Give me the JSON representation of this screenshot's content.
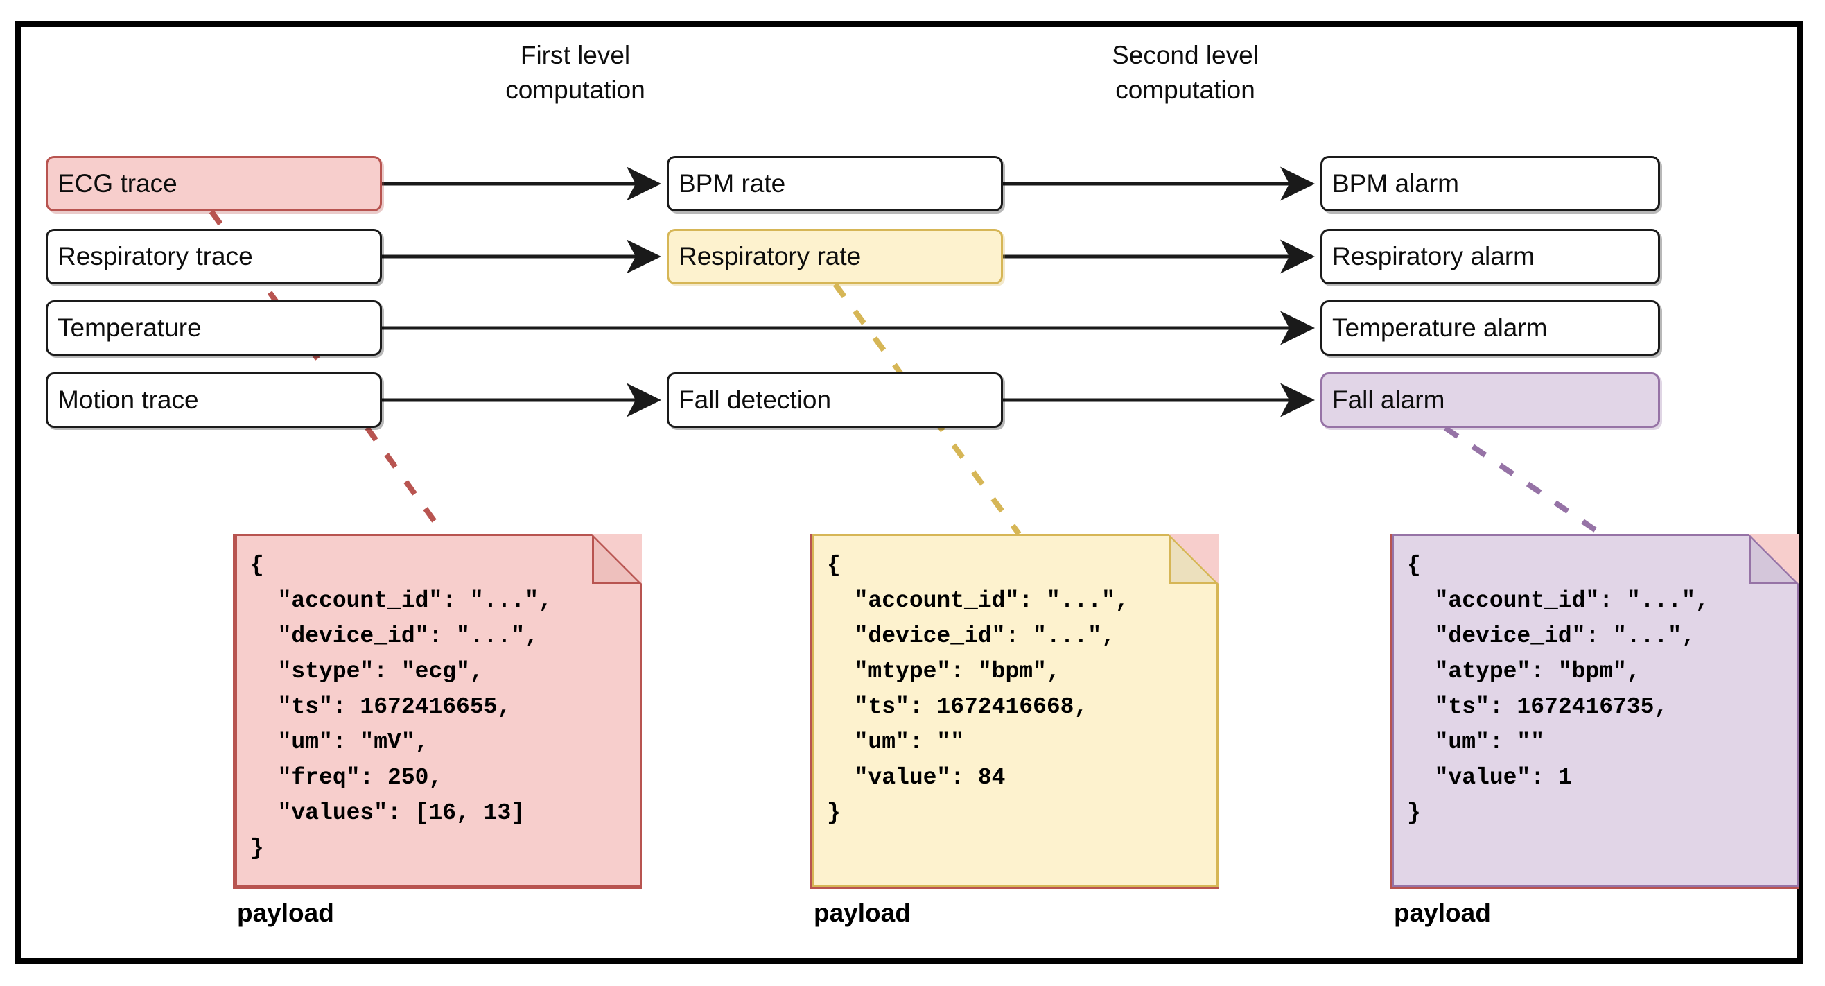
{
  "frame": {
    "border_color": "#000000",
    "background": "#ffffff"
  },
  "headings": {
    "first": "First level\ncomputation",
    "second": "Second level\ncomputation"
  },
  "palette": {
    "red_fill": "#f7cecc",
    "red_stroke": "#b85450",
    "yellow_fill": "#fdf2ce",
    "yellow_stroke": "#d6b656",
    "purple_fill": "#e1d5e7",
    "purple_stroke": "#9673a6",
    "default_stroke": "#1a1a1a",
    "default_fill": "#ffffff"
  },
  "columns": {
    "sources": {
      "nodes": [
        {
          "label": "ECG trace",
          "highlight": "red"
        },
        {
          "label": "Respiratory trace",
          "highlight": "none"
        },
        {
          "label": "Temperature",
          "highlight": "none"
        },
        {
          "label": "Motion trace",
          "highlight": "none"
        }
      ]
    },
    "first_level": {
      "nodes": [
        {
          "label": "BPM rate",
          "highlight": "none"
        },
        {
          "label": "Respiratory rate",
          "highlight": "yellow"
        },
        {
          "label": "Fall detection",
          "highlight": "none"
        }
      ]
    },
    "second_level": {
      "nodes": [
        {
          "label": "BPM alarm",
          "highlight": "none"
        },
        {
          "label": "Respiratory alarm",
          "highlight": "none"
        },
        {
          "label": "Temperature alarm",
          "highlight": "none"
        },
        {
          "label": "Fall alarm",
          "highlight": "purple"
        }
      ]
    }
  },
  "payloads": [
    {
      "caption": "payload",
      "color": "red",
      "code": "{\n  \"account_id\": \"...\",\n  \"device_id\": \"...\",\n  \"stype\": \"ecg\",\n  \"ts\": 1672416655,\n  \"um\": \"mV\",\n  \"freq\": 250,\n  \"values\": [16, 13]\n}"
    },
    {
      "caption": "payload",
      "color": "yellow",
      "code": "{\n  \"account_id\": \"...\",\n  \"device_id\": \"...\",\n  \"mtype\": \"bpm\",\n  \"ts\": 1672416668,\n  \"um\": \"\"\n  \"value\": 84\n}"
    },
    {
      "caption": "payload",
      "color": "purple",
      "code": "{\n  \"account_id\": \"...\",\n  \"device_id\": \"...\",\n  \"atype\": \"bpm\",\n  \"ts\": 1672416735,\n  \"um\": \"\"\n  \"value\": 1\n}"
    }
  ]
}
